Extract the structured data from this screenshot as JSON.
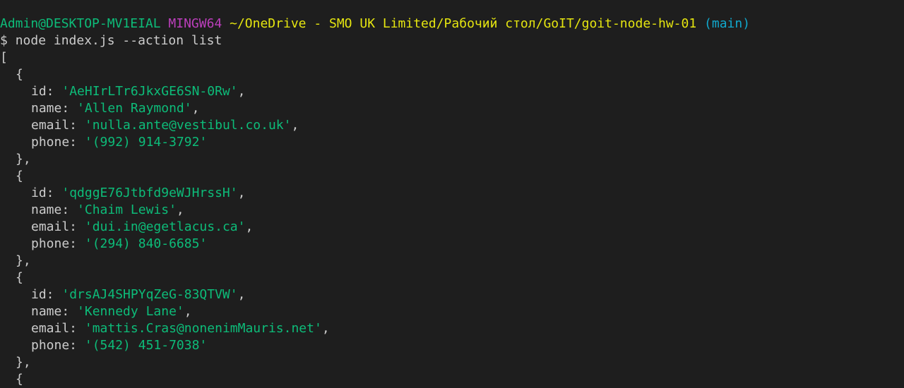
{
  "prompt": {
    "user_host": "Admin@DESKTOP-MV1EIAL",
    "shell": "MINGW64",
    "path": "~/OneDrive - SMO UK Limited/Рабочий стол/GoIT/goit-node-hw-01",
    "branch": "(main)"
  },
  "command": {
    "symbol": "$",
    "text": "node index.js --action list"
  },
  "output": {
    "open_bracket": "[",
    "open_brace": "{",
    "close_brace": "},",
    "keys": {
      "id": "id:",
      "name": "name:",
      "email": "email:",
      "phone": "phone:"
    },
    "contacts": [
      {
        "id": "'AeHIrLTr6JkxGE6SN-0Rw'",
        "name": "'Allen Raymond'",
        "email": "'nulla.ante@vestibul.co.uk'",
        "phone": "'(992) 914-3792'"
      },
      {
        "id": "'qdggE76Jtbfd9eWJHrssH'",
        "name": "'Chaim Lewis'",
        "email": "'dui.in@egetlacus.ca'",
        "phone": "'(294) 840-6685'"
      },
      {
        "id": "'drsAJ4SHPYqZeG-83QTVW'",
        "name": "'Kennedy Lane'",
        "email": "'mattis.Cras@nonenimMauris.net'",
        "phone": "'(542) 451-7038'"
      }
    ]
  }
}
